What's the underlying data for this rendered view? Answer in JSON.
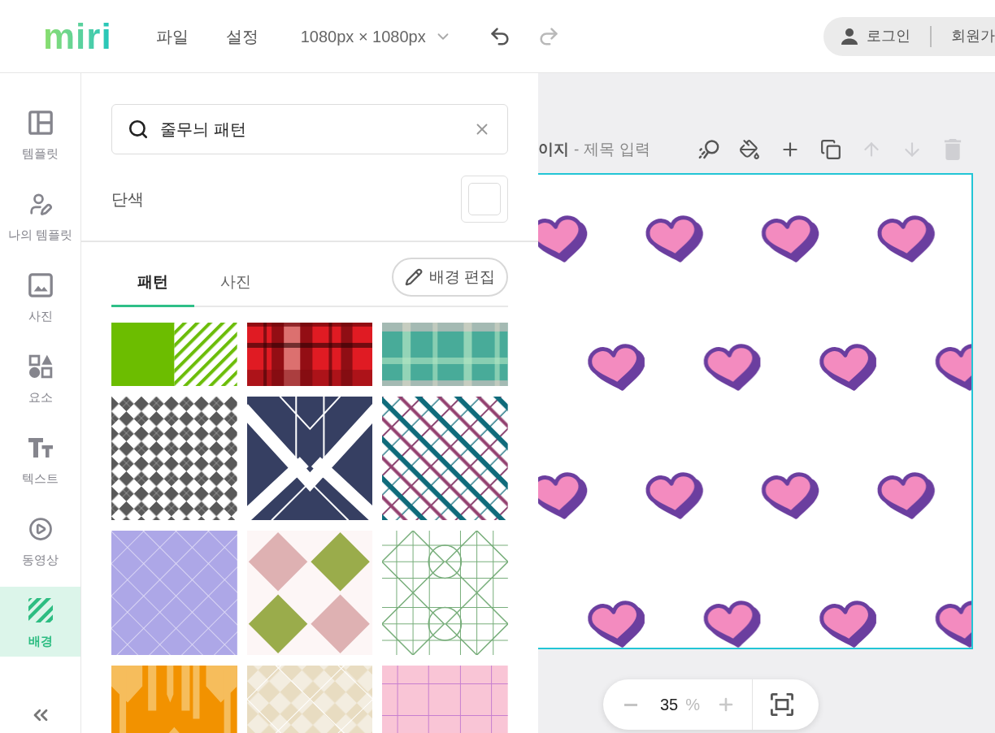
{
  "header": {
    "logo": "miri",
    "menu": [
      {
        "label": "파일"
      },
      {
        "label": "설정"
      }
    ],
    "canvas_size": "1080px × 1080px",
    "history": [
      {
        "kind": "undo",
        "disabled": false
      },
      {
        "kind": "redo",
        "disabled": true
      }
    ],
    "account": {
      "login": "로그인",
      "signup": "회원가"
    }
  },
  "sidebar": {
    "items": [
      {
        "kind": "template",
        "label": "템플릿",
        "selected": false
      },
      {
        "kind": "my_template",
        "label": "나의 템플릿",
        "selected": false
      },
      {
        "kind": "photo",
        "label": "사진",
        "selected": false
      },
      {
        "kind": "element",
        "label": "요소",
        "selected": false
      },
      {
        "kind": "text",
        "label": "텍스트",
        "selected": false
      },
      {
        "kind": "video",
        "label": "동영상",
        "selected": false
      },
      {
        "kind": "background",
        "label": "배경",
        "selected": true
      }
    ]
  },
  "panel": {
    "search": {
      "value": "줄무늬 패턴"
    },
    "solid_color": {
      "label": "단색"
    },
    "tabs": [
      {
        "label": "패턴",
        "selected": true
      },
      {
        "label": "사진",
        "selected": false
      }
    ],
    "edit_button": "배경 편집",
    "patterns": [
      {
        "kind": "stripes"
      },
      {
        "kind": "tartan"
      },
      {
        "kind": "plaid"
      },
      {
        "kind": "checker"
      },
      {
        "kind": "deco"
      },
      {
        "kind": "crosshatch"
      },
      {
        "kind": "lattice"
      },
      {
        "kind": "argyle"
      },
      {
        "kind": "octagon"
      },
      {
        "kind": "bars"
      },
      {
        "kind": "diamond"
      },
      {
        "kind": "grid"
      }
    ]
  },
  "canvas": {
    "page_label": "이지",
    "separator": "-",
    "title_placeholder": "제목 입력",
    "tools": [
      {
        "kind": "magic",
        "disabled": false
      },
      {
        "kind": "fill",
        "disabled": false
      },
      {
        "kind": "add",
        "disabled": false
      },
      {
        "kind": "duplicate",
        "disabled": false
      },
      {
        "kind": "up",
        "disabled": true
      },
      {
        "kind": "down",
        "disabled": true
      },
      {
        "kind": "delete",
        "disabled": true
      }
    ],
    "zoom": {
      "value": "35",
      "unit": "%"
    }
  }
}
